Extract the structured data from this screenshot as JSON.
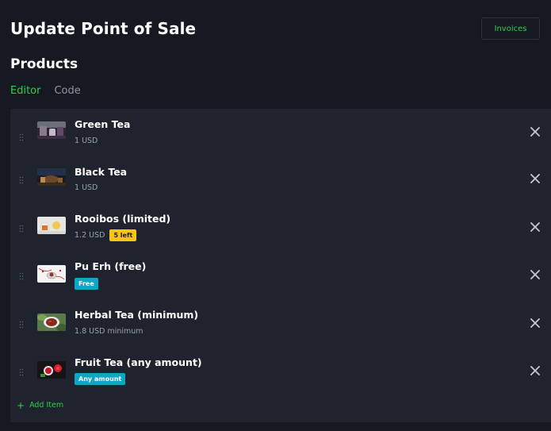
{
  "header": {
    "title": "Update Point of Sale",
    "invoices_label": "Invoices"
  },
  "products": {
    "section_title": "Products",
    "tabs": [
      {
        "label": "Editor",
        "active": true
      },
      {
        "label": "Code",
        "active": false
      }
    ],
    "items": [
      {
        "name": "Green Tea",
        "price": "1 USD",
        "badge": null,
        "thumbnail": "green-tea-thumbnail"
      },
      {
        "name": "Black Tea",
        "price": "1 USD",
        "badge": null,
        "thumbnail": "black-tea-thumbnail"
      },
      {
        "name": "Rooibos (limited)",
        "price": "1.2 USD",
        "badge": "5 left",
        "badge_color": "#f5c518",
        "thumbnail": "rooibos-thumbnail"
      },
      {
        "name": "Pu Erh (free)",
        "price": "",
        "badge": "Free",
        "badge_color": "#10a5c4",
        "thumbnail": "pu-erh-thumbnail"
      },
      {
        "name": "Herbal Tea (minimum)",
        "price": "1.8 USD minimum",
        "badge": null,
        "thumbnail": "herbal-tea-thumbnail"
      },
      {
        "name": "Fruit Tea (any amount)",
        "price": "",
        "badge": "Any amount",
        "badge_color": "#10a5c4",
        "thumbnail": "fruit-tea-thumbnail"
      }
    ],
    "add_item_label": "Add Item"
  },
  "colors": {
    "background": "#161922",
    "panel": "#1f232d",
    "accent": "#2bd04a",
    "muted_text": "#9aa0ad"
  }
}
